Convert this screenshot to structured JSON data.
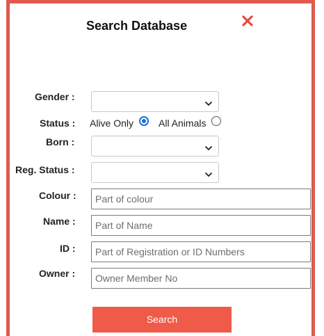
{
  "dialog": {
    "title": "Search Database",
    "close_icon": "close-x-icon",
    "accent_color": "#e05a4e"
  },
  "form": {
    "gender": {
      "label": "Gender :",
      "selected": ""
    },
    "status": {
      "label": "Status :",
      "options": [
        {
          "label": "Alive Only",
          "checked": true
        },
        {
          "label": "All Animals",
          "checked": false
        }
      ]
    },
    "born": {
      "label": "Born :",
      "selected": ""
    },
    "reg_status": {
      "label": "Reg. Status :",
      "selected": ""
    },
    "colour": {
      "label": "Colour :",
      "value": "",
      "placeholder": "Part of colour"
    },
    "name": {
      "label": "Name :",
      "value": "",
      "placeholder": "Part of Name"
    },
    "id": {
      "label": "ID :",
      "value": "",
      "placeholder": "Part of Registration or ID Numbers"
    },
    "owner": {
      "label": "Owner :",
      "value": "",
      "placeholder": "Owner Member No"
    }
  },
  "actions": {
    "search_label": "Search",
    "search_color": "#f05a48"
  }
}
